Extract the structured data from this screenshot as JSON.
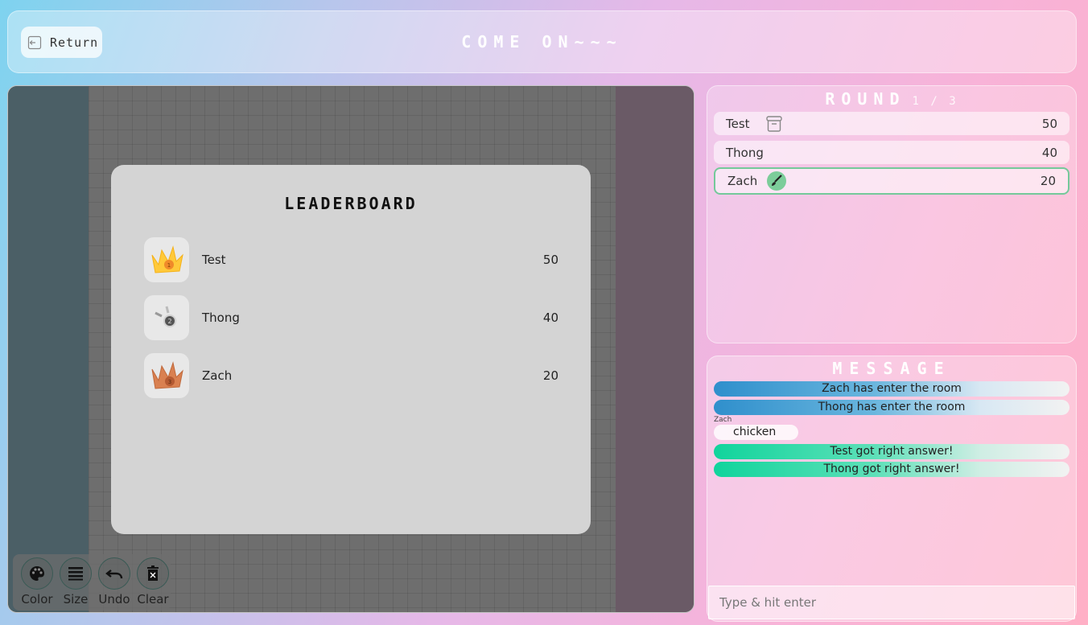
{
  "header": {
    "return_label": "Return",
    "title": "COME ON~~~"
  },
  "leaderboard": {
    "title": "LEADERBOARD",
    "entries": [
      {
        "name": "Test",
        "score": "50",
        "badge": "gold-crown-icon"
      },
      {
        "name": "Thong",
        "score": "40",
        "badge": "silver-medal-icon"
      },
      {
        "name": "Zach",
        "score": "20",
        "badge": "bronze-crown-icon"
      }
    ]
  },
  "tools": [
    {
      "label": "Color",
      "icon": "palette-icon"
    },
    {
      "label": "Size",
      "icon": "lines-icon"
    },
    {
      "label": "Undo",
      "icon": "undo-icon"
    },
    {
      "label": "Clear",
      "icon": "trash-icon"
    }
  ],
  "round": {
    "title": "ROUND",
    "count": "1 / 3",
    "players": [
      {
        "name": "Test",
        "score": "50",
        "icon": "box-icon"
      },
      {
        "name": "Thong",
        "score": "40",
        "icon": ""
      },
      {
        "name": "Zach",
        "score": "20",
        "icon": "brush-icon",
        "active": true
      }
    ]
  },
  "messages": {
    "title": "MESSAGE",
    "system": [
      {
        "text": "Zach has enter the room",
        "kind": "enter"
      },
      {
        "text": "Thong has enter the room",
        "kind": "enter"
      },
      {
        "text": "Test got right answer!",
        "kind": "right"
      },
      {
        "text": "Thong got right answer!",
        "kind": "right"
      }
    ],
    "chat": {
      "sender": "Zach",
      "text": "chicken"
    },
    "input_placeholder": "Type & hit enter"
  },
  "colors": {
    "active_border": "#74c99a",
    "enter_gradient": "#2f8fcc",
    "right_gradient": "#10d49c"
  }
}
